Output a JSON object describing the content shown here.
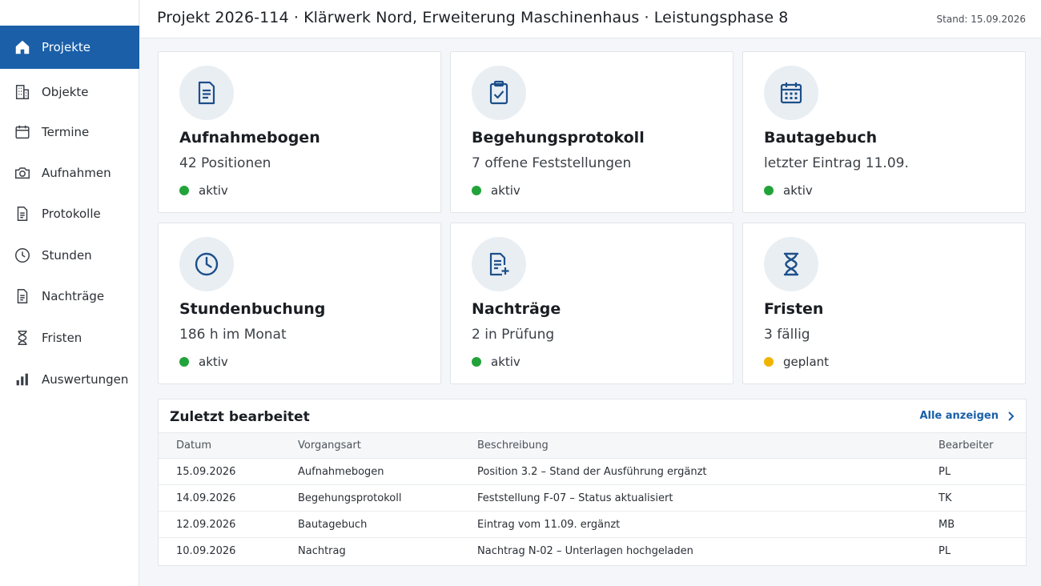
{
  "header": {
    "title": "Projekt 2026-114 · Klärwerk Nord, Erweiterung Maschinenhaus · Leistungsphase 8",
    "stand": "Stand: 15.09.2026"
  },
  "sidebar": {
    "items": [
      {
        "label": "Projekte",
        "icon": "home-icon",
        "active": true
      },
      {
        "label": "Objekte",
        "icon": "building-icon"
      },
      {
        "label": "Termine",
        "icon": "calendar-icon"
      },
      {
        "label": "Aufnahmen",
        "icon": "camera-icon"
      },
      {
        "label": "Protokolle",
        "icon": "document-icon"
      },
      {
        "label": "Stunden",
        "icon": "clock-icon"
      },
      {
        "label": "Nachträge",
        "icon": "document-icon"
      },
      {
        "label": "Fristen",
        "icon": "hourglass-icon"
      },
      {
        "label": "Auswertungen",
        "icon": "bar-chart-icon"
      }
    ]
  },
  "cards": [
    {
      "title": "Aufnahmebogen",
      "sub": "42 Positionen",
      "status": "aktiv",
      "status_color": "#22a33a",
      "icon": "document-icon"
    },
    {
      "title": "Begehungsprotokoll",
      "sub": "7 offene Feststellungen",
      "status": "aktiv",
      "status_color": "#22a33a",
      "icon": "clipboard-check-icon"
    },
    {
      "title": "Bautagebuch",
      "sub": "letzter Eintrag 11.09.",
      "status": "aktiv",
      "status_color": "#22a33a",
      "icon": "calendar-icon"
    },
    {
      "title": "Stundenbuchung",
      "sub": "186 h im Monat",
      "status": "aktiv",
      "status_color": "#22a33a",
      "icon": "clock-icon"
    },
    {
      "title": "Nachträge",
      "sub": "2 in Prüfung",
      "status": "aktiv",
      "status_color": "#22a33a",
      "icon": "document-plus-icon"
    },
    {
      "title": "Fristen",
      "sub": "3 fällig",
      "status": "geplant",
      "status_color": "#f0b400",
      "icon": "hourglass-icon"
    }
  ],
  "recent": {
    "title": "Zuletzt bearbeitet",
    "link": "Alle anzeigen",
    "columns": [
      "Datum",
      "Vorgangsart",
      "Beschreibung",
      "Bearbeiter"
    ],
    "rows": [
      [
        "15.09.2026",
        "Aufnahmebogen",
        "Position 3.2 – Stand der Ausführung ergänzt",
        "PL"
      ],
      [
        "14.09.2026",
        "Begehungsprotokoll",
        "Feststellung F-07 – Status aktualisiert",
        "TK"
      ],
      [
        "12.09.2026",
        "Bautagebuch",
        "Eintrag vom 11.09. ergänzt",
        "MB"
      ],
      [
        "10.09.2026",
        "Nachtrag",
        "Nachtrag N-02 – Unterlagen hochgeladen",
        "PL"
      ]
    ]
  },
  "colors": {
    "accent": "#1a5fa8",
    "icon": "#1c4f8a"
  }
}
